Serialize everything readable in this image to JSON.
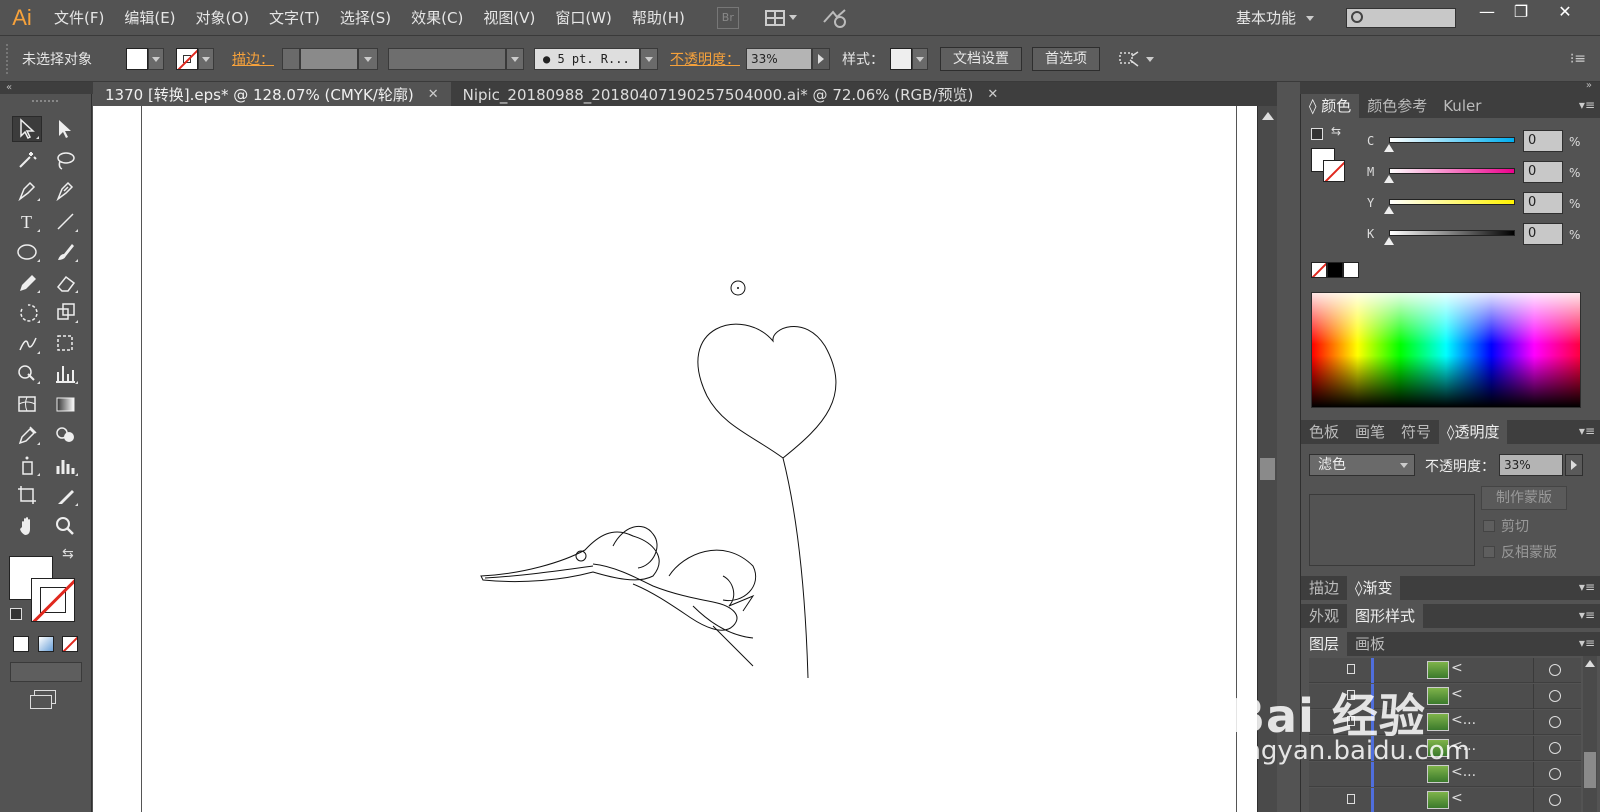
{
  "app": {
    "logo": "Ai"
  },
  "menu": {
    "items": [
      "文件(F)",
      "编辑(E)",
      "对象(O)",
      "文字(T)",
      "选择(S)",
      "效果(C)",
      "视图(V)",
      "窗口(W)",
      "帮助(H)"
    ],
    "bridge": "Br",
    "workspace": "基本功能",
    "window_buttons": [
      "—",
      "❐",
      "✕"
    ]
  },
  "control": {
    "selection_status": "未选择对象",
    "stroke_label": "描边：",
    "brush": "● 5 pt. R...",
    "opacity_label": "不透明度：",
    "opacity_value": "33%",
    "style_label": "样式：",
    "doc_setup_button": "文档设置",
    "preferences_button": "首选项"
  },
  "tabs": [
    {
      "label": "1370 [转换].eps* @ 128.07% (CMYK/轮廓)",
      "active": true
    },
    {
      "label": "Nipic_20180988_20180407190257504000.ai* @ 72.06% (RGB/预览)",
      "active": false
    }
  ],
  "color_panel": {
    "tabs": [
      "颜色",
      "颜色参考",
      "Kuler"
    ],
    "channels": [
      {
        "name": "C",
        "value": "0",
        "gradient": "#00aeef"
      },
      {
        "name": "M",
        "value": "0",
        "gradient": "#ec008c"
      },
      {
        "name": "Y",
        "value": "0",
        "gradient": "#fff200"
      },
      {
        "name": "K",
        "value": "0",
        "gradient": "#000000"
      }
    ],
    "percent": "%"
  },
  "transparency_panel": {
    "tabs": [
      "色板",
      "画笔",
      "符号",
      "透明度"
    ],
    "blend_mode": "滤色",
    "opacity_label": "不透明度：",
    "opacity_value": "33%",
    "make_mask_button": "制作蒙版",
    "clip_label": "剪切",
    "invert_label": "反相蒙版"
  },
  "stroke_gradient_panel": {
    "tabs": [
      "描边",
      "渐变"
    ]
  },
  "appearance_panel": {
    "tabs": [
      "外观",
      "图形样式"
    ]
  },
  "layers_panel": {
    "tabs": [
      "图层",
      "画板"
    ],
    "rows": [
      {
        "name": "<",
        "locked": true
      },
      {
        "name": "<",
        "locked": true
      },
      {
        "name": "<...",
        "locked": true
      },
      {
        "name": "<...",
        "locked": false
      },
      {
        "name": "<...",
        "locked": false
      },
      {
        "name": "<",
        "locked": true
      }
    ]
  },
  "watermark": {
    "logo": "Bai 经验",
    "url": "jingyan.baidu.com"
  }
}
